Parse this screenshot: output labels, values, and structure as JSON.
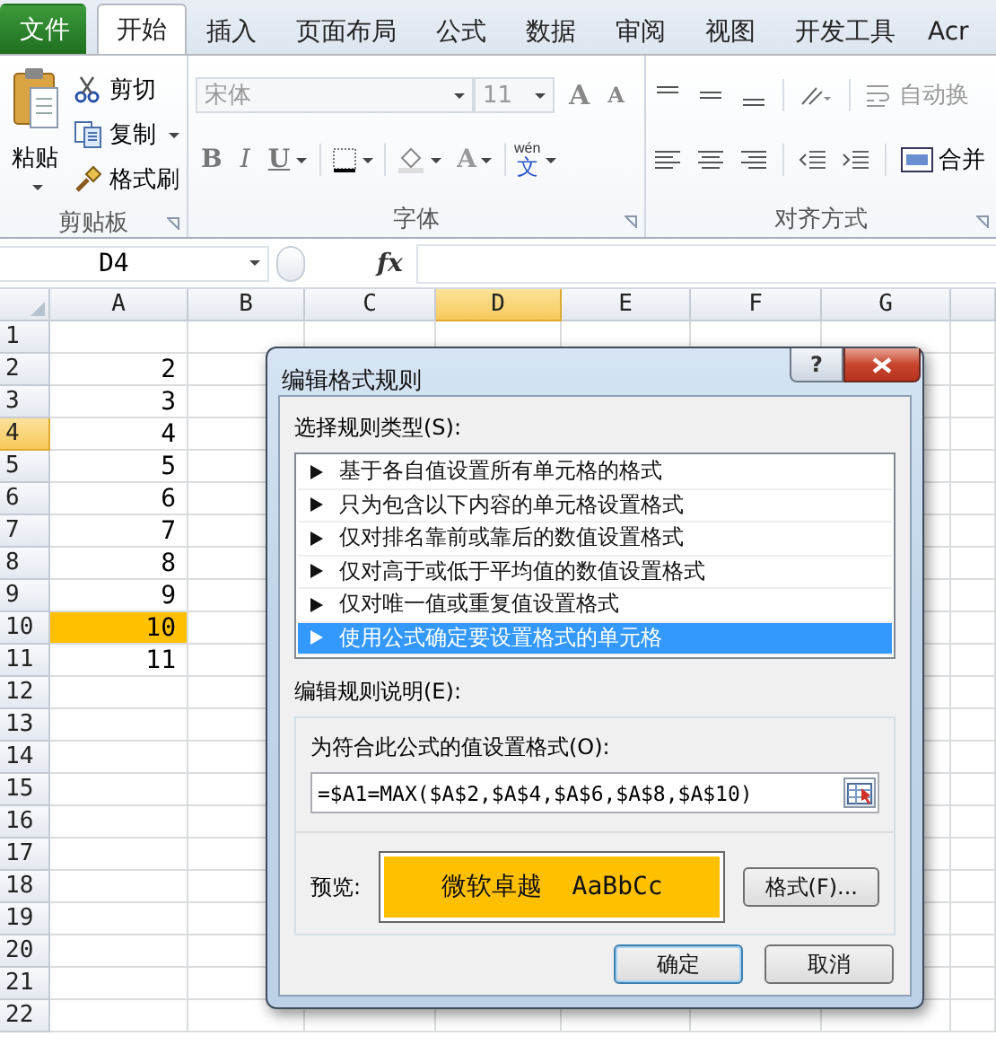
{
  "ribbon": {
    "tabs": [
      {
        "label": "文件",
        "kind": "file",
        "selected": false
      },
      {
        "label": "开始",
        "kind": "tab",
        "selected": true
      },
      {
        "label": "插入",
        "kind": "tab",
        "selected": false
      },
      {
        "label": "页面布局",
        "kind": "tab",
        "selected": false
      },
      {
        "label": "公式",
        "kind": "tab",
        "selected": false
      },
      {
        "label": "数据",
        "kind": "tab",
        "selected": false
      },
      {
        "label": "审阅",
        "kind": "tab",
        "selected": false
      },
      {
        "label": "视图",
        "kind": "tab",
        "selected": false
      },
      {
        "label": "开发工具",
        "kind": "tab",
        "selected": false
      },
      {
        "label": "Acr",
        "kind": "tab",
        "selected": false
      }
    ],
    "clipboard": {
      "label": "剪贴板",
      "paste": "粘贴",
      "cut": "剪切",
      "copy": "复制",
      "format_painter": "格式刷"
    },
    "font": {
      "label": "字体",
      "font_name": "宋体",
      "font_size": "11",
      "grow": "A",
      "shrink": "A",
      "bold": "B",
      "italic": "I",
      "underline": "U",
      "font_color": "A",
      "phonetic": "文",
      "phonetic_top": "wén"
    },
    "alignment": {
      "label": "对齐方式",
      "wrap_text": "自动换",
      "merge": "合并"
    }
  },
  "formula_bar": {
    "name_box": "D4",
    "fx": "fx"
  },
  "sheet": {
    "columns": [
      {
        "label": "A",
        "selected": false
      },
      {
        "label": "B",
        "selected": false
      },
      {
        "label": "C",
        "selected": false
      },
      {
        "label": "D",
        "selected": true
      },
      {
        "label": "E",
        "selected": false
      },
      {
        "label": "F",
        "selected": false
      },
      {
        "label": "G",
        "selected": false
      }
    ],
    "rows": [
      {
        "header": "1",
        "selected": false,
        "highlighted": false
      },
      {
        "header": "2",
        "selected": false,
        "highlighted": false,
        "a": "2"
      },
      {
        "header": "3",
        "selected": false,
        "highlighted": false,
        "a": "3"
      },
      {
        "header": "4",
        "selected": true,
        "highlighted": false,
        "a": "4"
      },
      {
        "header": "5",
        "selected": false,
        "highlighted": false,
        "a": "5"
      },
      {
        "header": "6",
        "selected": false,
        "highlighted": false,
        "a": "6"
      },
      {
        "header": "7",
        "selected": false,
        "highlighted": false,
        "a": "7"
      },
      {
        "header": "8",
        "selected": false,
        "highlighted": false,
        "a": "8"
      },
      {
        "header": "9",
        "selected": false,
        "highlighted": false,
        "a": "9"
      },
      {
        "header": "10",
        "selected": false,
        "highlighted": true,
        "a": "10"
      },
      {
        "header": "11",
        "selected": false,
        "highlighted": false,
        "a": "11"
      },
      {
        "header": "12",
        "selected": false,
        "highlighted": false
      },
      {
        "header": "13",
        "selected": false,
        "highlighted": false
      },
      {
        "header": "14",
        "selected": false,
        "highlighted": false
      },
      {
        "header": "15",
        "selected": false,
        "highlighted": false
      },
      {
        "header": "16",
        "selected": false,
        "highlighted": false
      },
      {
        "header": "17",
        "selected": false,
        "highlighted": false
      },
      {
        "header": "18",
        "selected": false,
        "highlighted": false
      },
      {
        "header": "19",
        "selected": false,
        "highlighted": false
      },
      {
        "header": "20",
        "selected": false,
        "highlighted": false
      },
      {
        "header": "21",
        "selected": false,
        "highlighted": false
      },
      {
        "header": "22",
        "selected": false,
        "highlighted": false
      }
    ]
  },
  "dialog": {
    "title": "编辑格式规则",
    "help": "?",
    "rule_type_label": "选择规则类型(S):",
    "rule_types": [
      {
        "label": "基于各自值设置所有单元格的格式",
        "selected": false
      },
      {
        "label": "只为包含以下内容的单元格设置格式",
        "selected": false
      },
      {
        "label": "仅对排名靠前或靠后的数值设置格式",
        "selected": false
      },
      {
        "label": "仅对高于或低于平均值的数值设置格式",
        "selected": false
      },
      {
        "label": "仅对唯一值或重复值设置格式",
        "selected": false
      },
      {
        "label": "使用公式确定要设置格式的单元格",
        "selected": true
      }
    ],
    "description_label": "编辑规则说明(E):",
    "formula_label": "为符合此公式的值设置格式(O):",
    "formula": "=$A1=MAX($A$2,$A$4,$A$6,$A$8,$A$10)",
    "preview_label": "预览:",
    "preview_sample": "微软卓越  AaBbCc",
    "format_button": "格式(F)...",
    "ok": "确定",
    "cancel": "取消"
  }
}
